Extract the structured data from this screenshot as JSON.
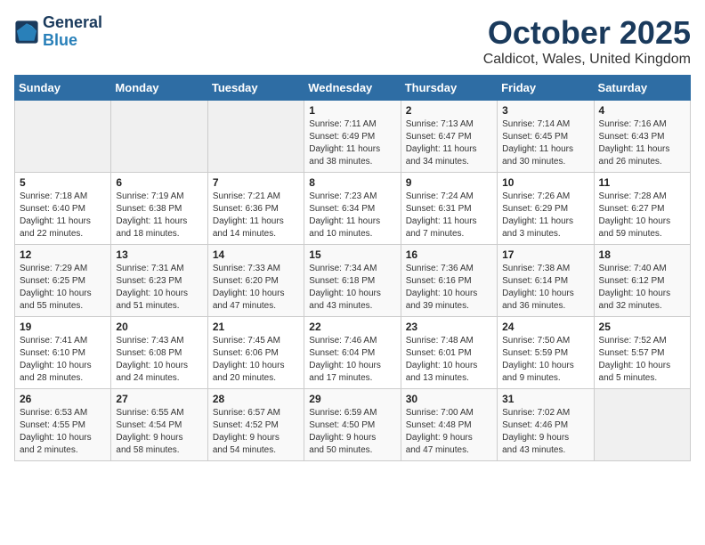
{
  "logo": {
    "line1": "General",
    "line2": "Blue"
  },
  "title": "October 2025",
  "location": "Caldicot, Wales, United Kingdom",
  "weekdays": [
    "Sunday",
    "Monday",
    "Tuesday",
    "Wednesday",
    "Thursday",
    "Friday",
    "Saturday"
  ],
  "weeks": [
    [
      {
        "day": "",
        "info": ""
      },
      {
        "day": "",
        "info": ""
      },
      {
        "day": "",
        "info": ""
      },
      {
        "day": "1",
        "info": "Sunrise: 7:11 AM\nSunset: 6:49 PM\nDaylight: 11 hours\nand 38 minutes."
      },
      {
        "day": "2",
        "info": "Sunrise: 7:13 AM\nSunset: 6:47 PM\nDaylight: 11 hours\nand 34 minutes."
      },
      {
        "day": "3",
        "info": "Sunrise: 7:14 AM\nSunset: 6:45 PM\nDaylight: 11 hours\nand 30 minutes."
      },
      {
        "day": "4",
        "info": "Sunrise: 7:16 AM\nSunset: 6:43 PM\nDaylight: 11 hours\nand 26 minutes."
      }
    ],
    [
      {
        "day": "5",
        "info": "Sunrise: 7:18 AM\nSunset: 6:40 PM\nDaylight: 11 hours\nand 22 minutes."
      },
      {
        "day": "6",
        "info": "Sunrise: 7:19 AM\nSunset: 6:38 PM\nDaylight: 11 hours\nand 18 minutes."
      },
      {
        "day": "7",
        "info": "Sunrise: 7:21 AM\nSunset: 6:36 PM\nDaylight: 11 hours\nand 14 minutes."
      },
      {
        "day": "8",
        "info": "Sunrise: 7:23 AM\nSunset: 6:34 PM\nDaylight: 11 hours\nand 10 minutes."
      },
      {
        "day": "9",
        "info": "Sunrise: 7:24 AM\nSunset: 6:31 PM\nDaylight: 11 hours\nand 7 minutes."
      },
      {
        "day": "10",
        "info": "Sunrise: 7:26 AM\nSunset: 6:29 PM\nDaylight: 11 hours\nand 3 minutes."
      },
      {
        "day": "11",
        "info": "Sunrise: 7:28 AM\nSunset: 6:27 PM\nDaylight: 10 hours\nand 59 minutes."
      }
    ],
    [
      {
        "day": "12",
        "info": "Sunrise: 7:29 AM\nSunset: 6:25 PM\nDaylight: 10 hours\nand 55 minutes."
      },
      {
        "day": "13",
        "info": "Sunrise: 7:31 AM\nSunset: 6:23 PM\nDaylight: 10 hours\nand 51 minutes."
      },
      {
        "day": "14",
        "info": "Sunrise: 7:33 AM\nSunset: 6:20 PM\nDaylight: 10 hours\nand 47 minutes."
      },
      {
        "day": "15",
        "info": "Sunrise: 7:34 AM\nSunset: 6:18 PM\nDaylight: 10 hours\nand 43 minutes."
      },
      {
        "day": "16",
        "info": "Sunrise: 7:36 AM\nSunset: 6:16 PM\nDaylight: 10 hours\nand 39 minutes."
      },
      {
        "day": "17",
        "info": "Sunrise: 7:38 AM\nSunset: 6:14 PM\nDaylight: 10 hours\nand 36 minutes."
      },
      {
        "day": "18",
        "info": "Sunrise: 7:40 AM\nSunset: 6:12 PM\nDaylight: 10 hours\nand 32 minutes."
      }
    ],
    [
      {
        "day": "19",
        "info": "Sunrise: 7:41 AM\nSunset: 6:10 PM\nDaylight: 10 hours\nand 28 minutes."
      },
      {
        "day": "20",
        "info": "Sunrise: 7:43 AM\nSunset: 6:08 PM\nDaylight: 10 hours\nand 24 minutes."
      },
      {
        "day": "21",
        "info": "Sunrise: 7:45 AM\nSunset: 6:06 PM\nDaylight: 10 hours\nand 20 minutes."
      },
      {
        "day": "22",
        "info": "Sunrise: 7:46 AM\nSunset: 6:04 PM\nDaylight: 10 hours\nand 17 minutes."
      },
      {
        "day": "23",
        "info": "Sunrise: 7:48 AM\nSunset: 6:01 PM\nDaylight: 10 hours\nand 13 minutes."
      },
      {
        "day": "24",
        "info": "Sunrise: 7:50 AM\nSunset: 5:59 PM\nDaylight: 10 hours\nand 9 minutes."
      },
      {
        "day": "25",
        "info": "Sunrise: 7:52 AM\nSunset: 5:57 PM\nDaylight: 10 hours\nand 5 minutes."
      }
    ],
    [
      {
        "day": "26",
        "info": "Sunrise: 6:53 AM\nSunset: 4:55 PM\nDaylight: 10 hours\nand 2 minutes."
      },
      {
        "day": "27",
        "info": "Sunrise: 6:55 AM\nSunset: 4:54 PM\nDaylight: 9 hours\nand 58 minutes."
      },
      {
        "day": "28",
        "info": "Sunrise: 6:57 AM\nSunset: 4:52 PM\nDaylight: 9 hours\nand 54 minutes."
      },
      {
        "day": "29",
        "info": "Sunrise: 6:59 AM\nSunset: 4:50 PM\nDaylight: 9 hours\nand 50 minutes."
      },
      {
        "day": "30",
        "info": "Sunrise: 7:00 AM\nSunset: 4:48 PM\nDaylight: 9 hours\nand 47 minutes."
      },
      {
        "day": "31",
        "info": "Sunrise: 7:02 AM\nSunset: 4:46 PM\nDaylight: 9 hours\nand 43 minutes."
      },
      {
        "day": "",
        "info": ""
      }
    ]
  ]
}
